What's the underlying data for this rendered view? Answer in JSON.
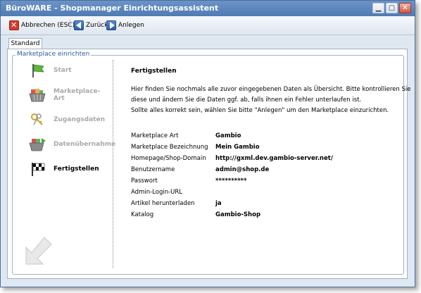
{
  "window": {
    "title": "BüroWARE - Shopmanager Einrichtungsassistent"
  },
  "toolbar": {
    "cancel_label": "Abbrechen (ESC)",
    "back_label": "Zurück",
    "create_label": "Anlegen"
  },
  "tabs": [
    {
      "label": "Standard"
    }
  ],
  "group": {
    "legend": "Marketplace einrichten"
  },
  "steps": [
    {
      "label": "Start",
      "icon": "flag-icon"
    },
    {
      "label": "Marketplace-Art",
      "icon": "shopping-basket-icon"
    },
    {
      "label": "Zugangsdaten",
      "icon": "keys-icon"
    },
    {
      "label": "Datenübernahme",
      "icon": "basket-transfer-icon"
    },
    {
      "label": "Fertigstellen",
      "icon": "checkered-flag-icon"
    }
  ],
  "content": {
    "heading": "Fertigstellen",
    "desc_lines": [
      "Hier finden Sie nochmals alle zuvor eingegebenen Daten als Übersicht. Bitte kontrollieren Sie",
      "diese und ändern Sie die Daten ggf. ab, falls ihnen ein Fehler unterlaufen ist.",
      "Sollte alles korrekt sein, wählen Sie bitte \"Anlegen\" um den Marketplace einzurichten."
    ],
    "summary": [
      {
        "label": "Marketplace Art",
        "value": "Gambio"
      },
      {
        "label": "Marketplace Bezeichnung",
        "value": "Mein Gambio"
      },
      {
        "label": "Homepage/Shop-Domain",
        "value": "http://gxml.dev.gambio-server.net/"
      },
      {
        "label": "Benutzername",
        "value": "admin@shop.de"
      },
      {
        "label": "Passwort",
        "value": "**********"
      },
      {
        "label": "Admin-Login-URL",
        "value": ""
      },
      {
        "label": "Artikel herunterladen",
        "value": "ja"
      },
      {
        "label": "Katalog",
        "value": "Gambio-Shop"
      }
    ]
  }
}
